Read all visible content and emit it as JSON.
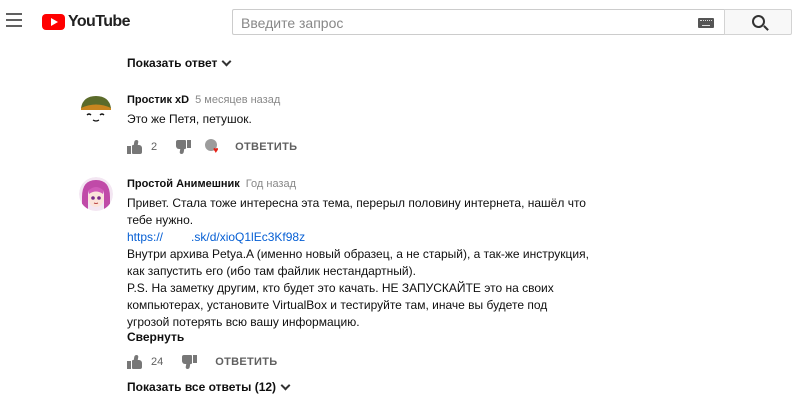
{
  "header": {
    "logo_text": "YouTube",
    "search_placeholder": "Введите запрос"
  },
  "show_reply": "Показать ответ",
  "comments": [
    {
      "author": "Простик xD",
      "time": "5 месяцев назад",
      "text": "Это же Петя, петушок.",
      "likes": "2",
      "reply_label": "ОТВЕТИТЬ",
      "creator_heart": true
    },
    {
      "author": "Простой Анимешник",
      "time": "Год назад",
      "lines": [
        "Привет. Стала тоже интересна эта тема, перерыл половину интернета, нашёл что",
        "тебе нужно.",
        "Внутри архива Petya.A (именно новый образец, а не старый), а так-же инструкция,",
        "как запустить его (ибо там файлик нестандартный).",
        "P.S. На заметку другим, кто будет это качать. НЕ ЗАПУСКАЙТЕ это на своих",
        "компьютерах, установите VirtualBox и тестируйте там, иначе вы будете под",
        "угрозой потерять всю вашу информацию."
      ],
      "link_start": "https://",
      "link_end": ".sk/d/xioQ1lEc3Kf98z",
      "collapse": "Свернуть",
      "likes": "24",
      "reply_label": "ОТВЕТИТЬ"
    }
  ],
  "show_all_replies": "Показать все ответы (12)",
  "colors": {
    "brand_red": "#ff0000",
    "link_blue": "#065fd4",
    "heart_red": "#e62117"
  }
}
